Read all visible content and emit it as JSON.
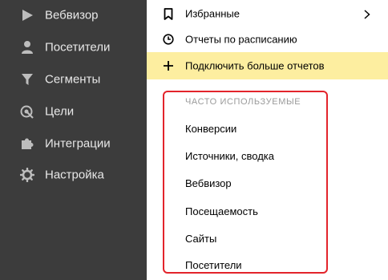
{
  "sidebar": {
    "items": [
      {
        "label": "Вебвизор",
        "icon": "play-icon"
      },
      {
        "label": "Посетители",
        "icon": "user-icon"
      },
      {
        "label": "Сегменты",
        "icon": "filter-icon"
      },
      {
        "label": "Цели",
        "icon": "target-icon"
      },
      {
        "label": "Интеграции",
        "icon": "puzzle-icon"
      },
      {
        "label": "Настройка",
        "icon": "gear-icon"
      }
    ]
  },
  "menu": {
    "favorites": {
      "label": "Избранные",
      "icon": "bookmark-icon"
    },
    "scheduled": {
      "label": "Отчеты по расписанию",
      "icon": "clock-icon"
    },
    "connect_more": {
      "label": "Подключить больше отчетов",
      "icon": "plus-icon"
    },
    "frequent": {
      "header": "ЧАСТО ИСПОЛЬЗУЕМЫЕ",
      "items": [
        "Конверсии",
        "Источники, сводка",
        "Вебвизор",
        "Посещаемость",
        "Сайты",
        "Посетители"
      ]
    }
  },
  "colors": {
    "sidebar_bg": "#3c3c3c",
    "highlight": "#fdeea0",
    "frame": "#e3242b"
  }
}
